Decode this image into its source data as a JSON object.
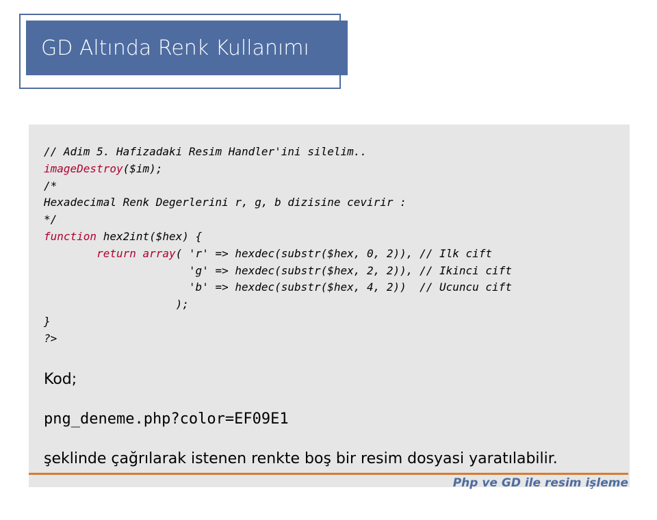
{
  "title": "GD Altında Renk Kullanımı",
  "code": {
    "l1": "// Adim 5. Hafizadaki Resim Handler'ini silelim..",
    "l2a": "imageDestroy",
    "l2b": "($im);",
    "l3": "",
    "l4": "/*",
    "l5": "Hexadecimal Renk Degerlerini r, g, b dizisine cevirir :",
    "l6": "*/",
    "l7a": "function",
    "l7b": " hex2int($hex) {",
    "l8a": "        return",
    "l8b": " array",
    "l8c": "( 'r' => hexdec(substr($hex, 0, 2)), // Ilk cift",
    "l9": "                      'g' => hexdec(substr($hex, 2, 2)), // Ikinci cift",
    "l10": "                      'b' => hexdec(substr($hex, 4, 2))  // Ucuncu cift",
    "l11": "                    );",
    "l12": "}",
    "l13": "?>"
  },
  "kod_label": "Kod;",
  "url": "png_deneme.php?color=EF09E1",
  "description": "şeklinde çağrılarak istenen renkte boş bir resim dosyasi yaratılabilir.",
  "footer": "Php ve GD ile resim işleme"
}
